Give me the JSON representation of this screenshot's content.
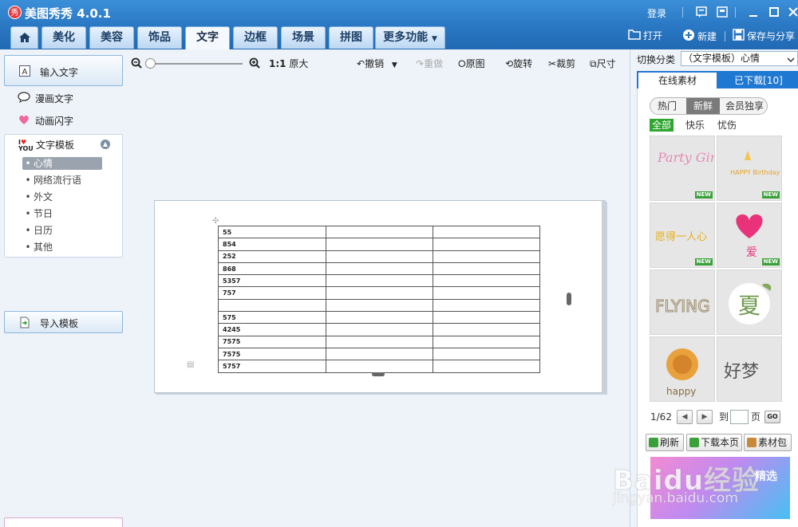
{
  "app": {
    "title": "美图秀秀 4.0.1",
    "logo_glyph": "秀",
    "login": "登录"
  },
  "tabs": [
    {
      "label": "美化"
    },
    {
      "label": "美容"
    },
    {
      "label": "饰品"
    },
    {
      "label": "文字"
    },
    {
      "label": "边框"
    },
    {
      "label": "场景"
    },
    {
      "label": "拼图"
    },
    {
      "label": "更多功能"
    }
  ],
  "header_actions": {
    "open": "打开",
    "new": "新建",
    "save_share": "保存与分享"
  },
  "left": {
    "input_text": "输入文字",
    "comic_text": "漫画文字",
    "animated_text": "动画闪字",
    "template": {
      "title": "文字模板",
      "items": [
        "心情",
        "网络流行语",
        "外文",
        "节日",
        "日历",
        "其他"
      ],
      "selected": "心情"
    },
    "import_template": "导入模板"
  },
  "toolbar": {
    "ratio": "1:1",
    "original_size": "原大",
    "undo": "撤销",
    "redo": "重做",
    "original": "原图",
    "rotate": "旋转",
    "crop": "裁剪",
    "resize": "尺寸"
  },
  "table": {
    "rows": [
      [
        "55",
        "",
        ""
      ],
      [
        "854",
        "",
        ""
      ],
      [
        "252",
        "",
        ""
      ],
      [
        "868",
        "",
        ""
      ],
      [
        "5357",
        "",
        ""
      ],
      [
        "757",
        "",
        ""
      ],
      [
        "",
        "",
        ""
      ],
      [
        "575",
        "",
        ""
      ],
      [
        "4245",
        "",
        ""
      ],
      [
        "7575",
        "",
        ""
      ],
      [
        "7575",
        "",
        ""
      ],
      [
        "5757",
        "",
        ""
      ]
    ]
  },
  "right": {
    "category_label": "切换分类",
    "category_value": "（文字模板）心情",
    "tab_online": "在线素材",
    "tab_downloaded": "已下载[10]",
    "pills": [
      "热门",
      "新鲜",
      "会员独享"
    ],
    "active_pill": "新鲜",
    "filters": [
      "全部",
      "快乐",
      "忧伤"
    ],
    "active_filter": "全部",
    "thumbs": [
      {
        "name": "party-girl",
        "new": true,
        "text": "Party Girl"
      },
      {
        "name": "happy-birthday",
        "new": true,
        "text": "HAPPY Birthday"
      },
      {
        "name": "wish-person",
        "new": true,
        "text": "愿得一人心"
      },
      {
        "name": "heart-love",
        "new": true,
        "text": "爱"
      },
      {
        "name": "flying",
        "new": false,
        "text": "FLYING"
      },
      {
        "name": "summer",
        "new": false,
        "text": "夏"
      },
      {
        "name": "happy-flower",
        "new": false,
        "text": "happy"
      },
      {
        "name": "good-dream",
        "new": false,
        "text": "好梦"
      }
    ],
    "new_badge": "NEW",
    "pager": {
      "current": "1/62",
      "to": "到",
      "page": "页",
      "go": "GO"
    },
    "refresh": "刷新",
    "download_page": "下载本页",
    "material_pack": "素材包"
  },
  "watermark": {
    "logo": "Baidu经验",
    "tag": "精选",
    "url": "jingyan.baidu.com"
  },
  "colors": {
    "titlebar": "#2a78c4",
    "accent": "#1f78d1",
    "badge": "#3aa03a"
  }
}
